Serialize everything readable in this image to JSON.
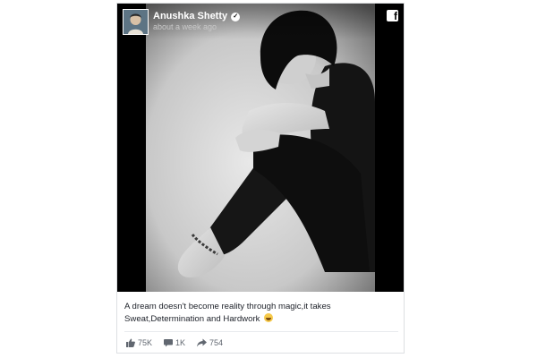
{
  "post": {
    "author": "Anushka Shetty",
    "time": "about a week ago",
    "caption": "A dream doesn't become reality through magic,it takes Sweat,Determination and Hardwork",
    "emoji": "smiling-emoji"
  },
  "stats": {
    "likes": "75K",
    "comments": "1K",
    "shares": "754"
  },
  "icons": {
    "brand": "facebook-icon",
    "verified": "verified-badge-icon",
    "like": "thumbs-up-icon",
    "comment": "comment-icon",
    "share": "share-arrow-icon"
  },
  "colors": {
    "text": "#1d2129",
    "meta": "#616770",
    "border": "#dddfe2"
  }
}
